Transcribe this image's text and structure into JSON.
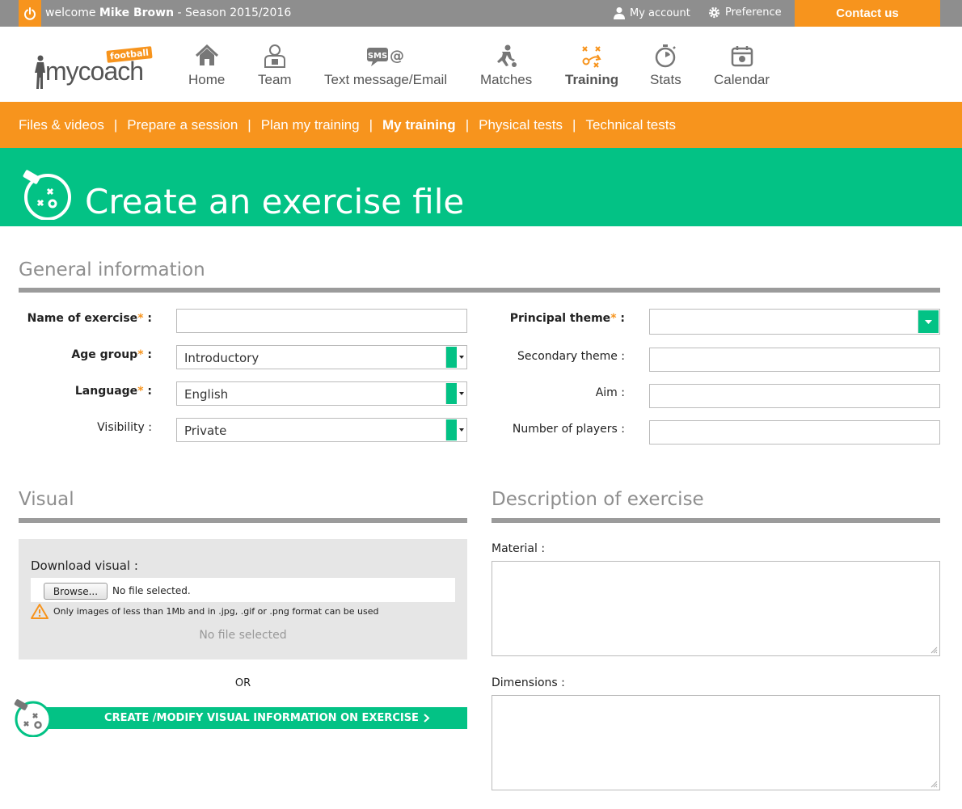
{
  "topbar": {
    "welcome_prefix": "welcome",
    "user_name": "Mike Brown",
    "season": "- Season 2015/2016",
    "my_account": "My account",
    "preference": "Preference",
    "contact": "Contact us"
  },
  "logo": {
    "text": "mycoach",
    "badge": "football"
  },
  "nav": [
    {
      "label": "Home",
      "icon": "home-icon"
    },
    {
      "label": "Team",
      "icon": "team-icon"
    },
    {
      "label": "Text message/Email",
      "icon": "sms-icon"
    },
    {
      "label": "Matches",
      "icon": "matches-icon"
    },
    {
      "label": "Training",
      "icon": "training-icon",
      "active": true
    },
    {
      "label": "Stats",
      "icon": "stats-icon"
    },
    {
      "label": "Calendar",
      "icon": "calendar-icon"
    }
  ],
  "subnav": [
    {
      "label": "Files & videos"
    },
    {
      "label": "Prepare a session"
    },
    {
      "label": "Plan my training"
    },
    {
      "label": "My training",
      "active": true
    },
    {
      "label": "Physical tests"
    },
    {
      "label": "Technical tests"
    }
  ],
  "banner": {
    "title": "Create an exercise file"
  },
  "general": {
    "title": "General information",
    "name_label": "Name of exercise",
    "age_label": "Age group",
    "age_value": "Introductory",
    "language_label": "Language",
    "language_value": "English",
    "visibility_label": "Visibility :",
    "visibility_value": "Private",
    "principal_label": "Principal theme",
    "secondary_label": "Secondary theme :",
    "aim_label": "Aim :",
    "players_label": "Number of players :",
    "required_mark": "*",
    "colon": " :"
  },
  "visual": {
    "title": "Visual",
    "download_label": "Download visual :",
    "browse": "Browse...",
    "no_file": "No file selected.",
    "warning": "Only images of less than 1Mb and in .jpg, .gif or .png format can be used",
    "no_file_selected": "No file selected",
    "or": "OR",
    "create_button": "CREATE /MODIFY VISUAL INFORMATION ON EXERCISE"
  },
  "description": {
    "title": "Description of exercise",
    "material_label": "Material :",
    "dimensions_label": "Dimensions :"
  },
  "colors": {
    "orange": "#f7941d",
    "green": "#03c285",
    "gray": "#8e8e8e"
  }
}
